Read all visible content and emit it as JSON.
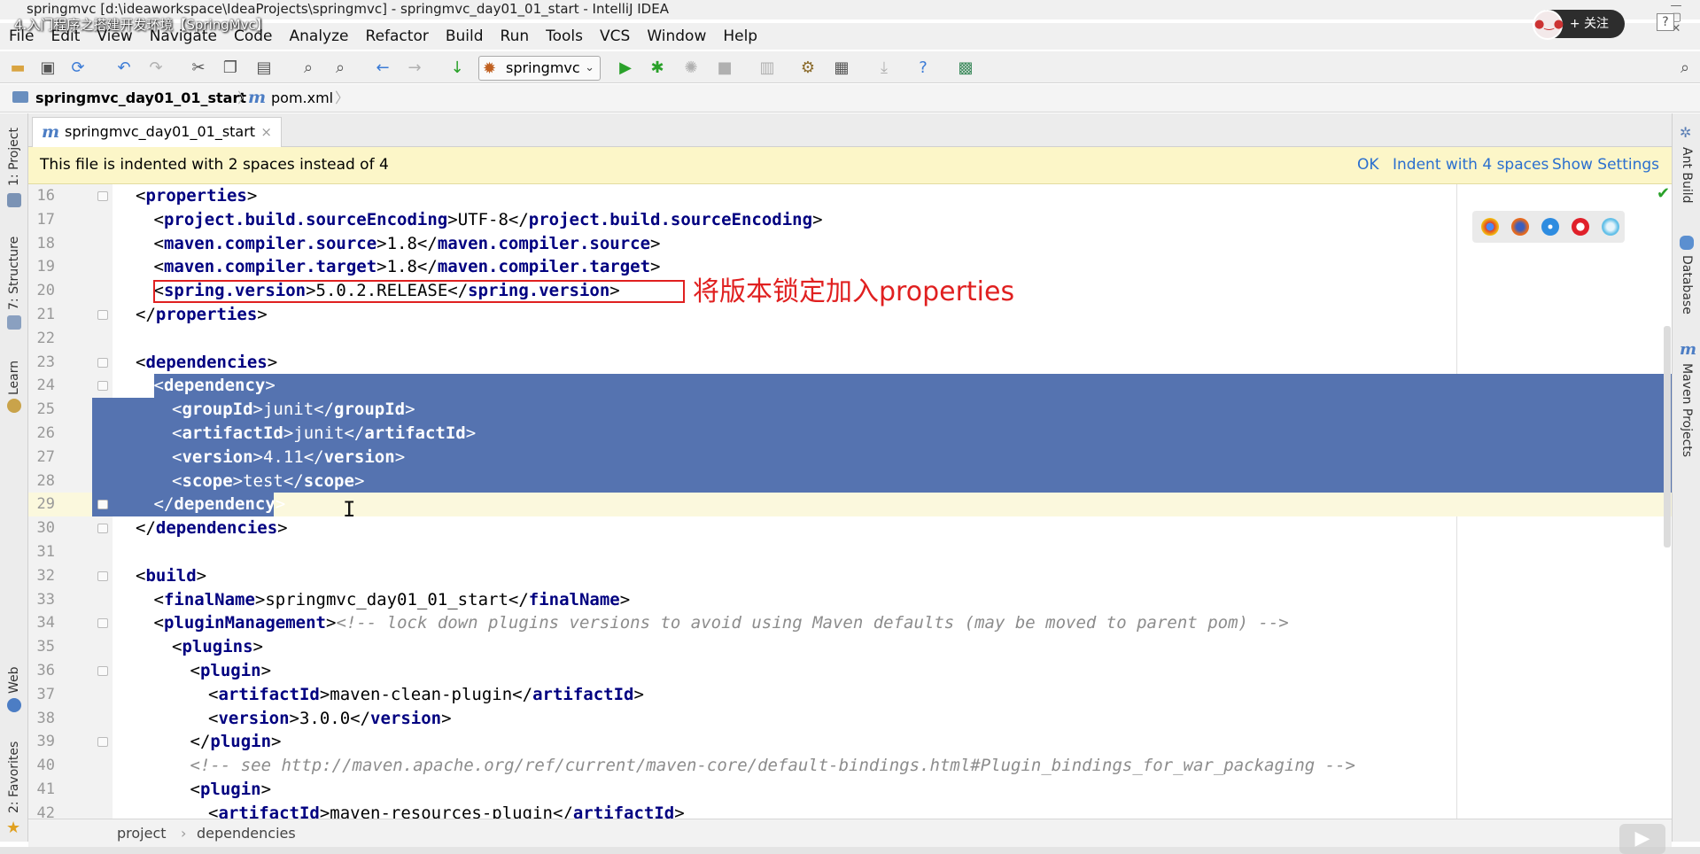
{
  "window": {
    "title": "springmvc [d:\\ideaworkspace\\IdeaProjects\\springmvc] - springmvc_day01_01_start - IntelliJ IDEA",
    "video_overlay_title": "4.入门程序之搭建开发环境【SpringMvc】",
    "follow_label": "+ 关注",
    "help_label": "?"
  },
  "menu": [
    "File",
    "Edit",
    "View",
    "Navigate",
    "Code",
    "Analyze",
    "Refactor",
    "Build",
    "Run",
    "Tools",
    "VCS",
    "Window",
    "Help"
  ],
  "toolbar": {
    "run_config": "springmvc"
  },
  "breadcrumb": {
    "module": "springmvc_day01_01_start",
    "file": "pom.xml"
  },
  "tab": {
    "label": "springmvc_day01_01_start",
    "close": "×"
  },
  "left_tools": [
    "1: Project",
    "7: Structure",
    "Learn",
    "Web",
    "2: Favorites"
  ],
  "right_tools": [
    "Ant Build",
    "Database",
    "Maven Projects"
  ],
  "notification": {
    "message": "This file is indented with 2 spaces instead of 4",
    "ok": "OK",
    "indent": "Indent with 4 spaces",
    "settings": "Show Settings"
  },
  "annotation": "将版本锁定加入properties",
  "code_lines": [
    {
      "n": "16",
      "i": 0,
      "parts": [
        [
          "br",
          "<"
        ],
        [
          "tg",
          "properties"
        ],
        [
          "br",
          ">"
        ]
      ]
    },
    {
      "n": "17",
      "i": 1,
      "parts": [
        [
          "br",
          "<"
        ],
        [
          "tg",
          "project.build.sourceEncoding"
        ],
        [
          "br",
          ">UTF-8</"
        ],
        [
          "tg",
          "project.build.sourceEncoding"
        ],
        [
          "br",
          ">"
        ]
      ]
    },
    {
      "n": "18",
      "i": 1,
      "parts": [
        [
          "br",
          "<"
        ],
        [
          "tg",
          "maven.compiler.source"
        ],
        [
          "br",
          ">1.8</"
        ],
        [
          "tg",
          "maven.compiler.source"
        ],
        [
          "br",
          ">"
        ]
      ]
    },
    {
      "n": "19",
      "i": 1,
      "parts": [
        [
          "br",
          "<"
        ],
        [
          "tg",
          "maven.compiler.target"
        ],
        [
          "br",
          ">1.8</"
        ],
        [
          "tg",
          "maven.compiler.target"
        ],
        [
          "br",
          ">"
        ]
      ]
    },
    {
      "n": "20",
      "i": 1,
      "parts": [
        [
          "br",
          "<"
        ],
        [
          "tg",
          "spring.version"
        ],
        [
          "br",
          ">5.0.2.RELEASE</"
        ],
        [
          "tg",
          "spring.version"
        ],
        [
          "br",
          ">"
        ]
      ]
    },
    {
      "n": "21",
      "i": 0,
      "parts": [
        [
          "br",
          "</"
        ],
        [
          "tg",
          "properties"
        ],
        [
          "br",
          ">"
        ]
      ]
    },
    {
      "n": "22",
      "i": 0,
      "parts": []
    },
    {
      "n": "23",
      "i": 0,
      "parts": [
        [
          "br",
          "<"
        ],
        [
          "tg",
          "dependencies"
        ],
        [
          "br",
          ">"
        ]
      ]
    },
    {
      "n": "24",
      "i": 1,
      "parts": [
        [
          "br",
          "<"
        ],
        [
          "tg",
          "dependency"
        ],
        [
          "br",
          ">"
        ]
      ]
    },
    {
      "n": "25",
      "i": 2,
      "parts": [
        [
          "br",
          "<"
        ],
        [
          "tg",
          "groupId"
        ],
        [
          "br",
          ">junit</"
        ],
        [
          "tg",
          "groupId"
        ],
        [
          "br",
          ">"
        ]
      ]
    },
    {
      "n": "26",
      "i": 2,
      "parts": [
        [
          "br",
          "<"
        ],
        [
          "tg",
          "artifactId"
        ],
        [
          "br",
          ">junit</"
        ],
        [
          "tg",
          "artifactId"
        ],
        [
          "br",
          ">"
        ]
      ]
    },
    {
      "n": "27",
      "i": 2,
      "parts": [
        [
          "br",
          "<"
        ],
        [
          "tg",
          "version"
        ],
        [
          "br",
          ">4.11</"
        ],
        [
          "tg",
          "version"
        ],
        [
          "br",
          ">"
        ]
      ]
    },
    {
      "n": "28",
      "i": 2,
      "parts": [
        [
          "br",
          "<"
        ],
        [
          "tg",
          "scope"
        ],
        [
          "br",
          ">test</"
        ],
        [
          "tg",
          "scope"
        ],
        [
          "br",
          ">"
        ]
      ]
    },
    {
      "n": "29",
      "i": 1,
      "parts": [
        [
          "br",
          "</"
        ],
        [
          "tg",
          "dependency"
        ],
        [
          "br",
          ">"
        ]
      ]
    },
    {
      "n": "30",
      "i": 0,
      "parts": [
        [
          "br",
          "</"
        ],
        [
          "tg",
          "dependencies"
        ],
        [
          "br",
          ">"
        ]
      ]
    },
    {
      "n": "31",
      "i": 0,
      "parts": []
    },
    {
      "n": "32",
      "i": 0,
      "parts": [
        [
          "br",
          "<"
        ],
        [
          "tg",
          "build"
        ],
        [
          "br",
          ">"
        ]
      ]
    },
    {
      "n": "33",
      "i": 1,
      "parts": [
        [
          "br",
          "<"
        ],
        [
          "tg",
          "finalName"
        ],
        [
          "br",
          ">springmvc_day01_01_start</"
        ],
        [
          "tg",
          "finalName"
        ],
        [
          "br",
          ">"
        ]
      ]
    },
    {
      "n": "34",
      "i": 1,
      "parts": [
        [
          "br",
          "<"
        ],
        [
          "tg",
          "pluginManagement"
        ],
        [
          "br",
          ">"
        ],
        [
          "cm",
          "<!-- lock down plugins versions to avoid using Maven defaults (may be moved to parent pom) -->"
        ]
      ]
    },
    {
      "n": "35",
      "i": 2,
      "parts": [
        [
          "br",
          "<"
        ],
        [
          "tg",
          "plugins"
        ],
        [
          "br",
          ">"
        ]
      ]
    },
    {
      "n": "36",
      "i": 3,
      "parts": [
        [
          "br",
          "<"
        ],
        [
          "tg",
          "plugin"
        ],
        [
          "br",
          ">"
        ]
      ]
    },
    {
      "n": "37",
      "i": 4,
      "parts": [
        [
          "br",
          "<"
        ],
        [
          "tg",
          "artifactId"
        ],
        [
          "br",
          ">maven-clean-plugin</"
        ],
        [
          "tg",
          "artifactId"
        ],
        [
          "br",
          ">"
        ]
      ]
    },
    {
      "n": "38",
      "i": 4,
      "parts": [
        [
          "br",
          "<"
        ],
        [
          "tg",
          "version"
        ],
        [
          "br",
          ">3.0.0</"
        ],
        [
          "tg",
          "version"
        ],
        [
          "br",
          ">"
        ]
      ]
    },
    {
      "n": "39",
      "i": 3,
      "parts": [
        [
          "br",
          "</"
        ],
        [
          "tg",
          "plugin"
        ],
        [
          "br",
          ">"
        ]
      ]
    },
    {
      "n": "40",
      "i": 3,
      "parts": [
        [
          "cm",
          "<!-- see http://maven.apache.org/ref/current/maven-core/default-bindings.html#Plugin_bindings_for_war_packaging -->"
        ]
      ]
    },
    {
      "n": "41",
      "i": 3,
      "parts": [
        [
          "br",
          "<"
        ],
        [
          "tg",
          "plugin"
        ],
        [
          "br",
          ">"
        ]
      ]
    },
    {
      "n": "42",
      "i": 4,
      "parts": [
        [
          "br",
          "<"
        ],
        [
          "tg",
          "artifactId"
        ],
        [
          "br",
          ">maven-resources-plugin</"
        ],
        [
          "tg",
          "artifactId"
        ],
        [
          "br",
          ">"
        ]
      ]
    }
  ],
  "selection": {
    "start": "24",
    "end": "29"
  },
  "current_line": "29",
  "statusbar": {
    "path1": "project",
    "separator": "›",
    "path2": "dependencies"
  },
  "colors": {
    "selection": "#5573b0",
    "tag": "#000080",
    "comment": "#8c8c8c",
    "annotation": "#e02020",
    "link": "#2a6fcf"
  }
}
